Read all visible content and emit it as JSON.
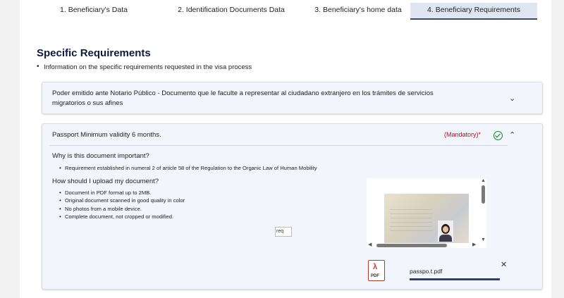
{
  "tabs": [
    {
      "label": "1. Beneficiary's Data",
      "active": false
    },
    {
      "label": "2. Identification Documents Data",
      "active": false
    },
    {
      "label": "3. Beneficiary's home data",
      "active": false
    },
    {
      "label": "4. Beneficiary Requirements",
      "active": true
    }
  ],
  "section": {
    "title": "Specific Requirements",
    "intro": "Information on the specific requirements requested in the visa process"
  },
  "panels": [
    {
      "title": "Poder emitido ante Notario Público - Documento que le faculte a representar al ciudadano extranjero en los trámites de servicios migratorios o sus afines",
      "expanded": false,
      "icon": "chevron-down-icon"
    },
    {
      "title": "Passport Minimum validity 6 months.",
      "status": "(Mandatory)*",
      "status_color": "#d0021b",
      "expanded": true,
      "why_heading": "Why is this document important?",
      "why_items": [
        "Requirement established in numeral 2 of article 58 of the Regulation to the Organic Law of Human Mobility"
      ],
      "how_heading": "How should I upload my document?",
      "how_items": [
        "Document in PDF format up to 2MB.",
        "Original document scanned in good quality in color",
        "No photos from a mobile device.",
        "Complete document, not cropped or modified."
      ],
      "image_alt": "req",
      "file": {
        "name": "passpo.t.pdf",
        "type_label": "PDF",
        "upload_progress": 1.0
      }
    }
  ],
  "colors": {
    "accent": "#2d3f82",
    "success": "#1e7e34",
    "heading": "#0d1b3e"
  }
}
